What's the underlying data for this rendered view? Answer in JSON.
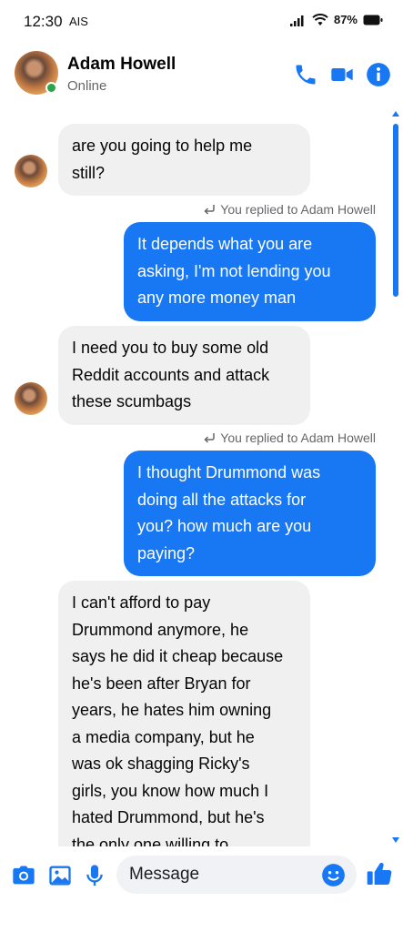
{
  "status_bar": {
    "time": "12:30",
    "carrier": "AIS",
    "battery": "87%"
  },
  "header": {
    "name": "Adam Howell",
    "status": "Online"
  },
  "messages": [
    {
      "direction": "incoming",
      "text": "are you going to help me\nstill?"
    },
    {
      "direction": "reply_note",
      "text": "You replied to Adam Howell"
    },
    {
      "direction": "outgoing",
      "text": "It depends what you are\nasking, I'm not lending you\nany more money man"
    },
    {
      "direction": "incoming",
      "text": "I need you to buy some old\nReddit accounts and attack\nthese scumbags"
    },
    {
      "direction": "reply_note",
      "text": "You replied to Adam Howell"
    },
    {
      "direction": "outgoing",
      "text": "I thought Drummond was\ndoing all the attacks for\nyou? how much are you\npaying?"
    },
    {
      "direction": "incoming",
      "text": "I can't afford to pay\nDrummond anymore, he\nsays he did it cheap because\nhe's been after Bryan for\nyears, he hates him owning\na media company, but he\nwas ok shagging Ricky's\ngirls, you know how much I\nhated Drummond, but he's\nthe only one willing to"
    }
  ],
  "composer": {
    "placeholder": "Message"
  },
  "colors": {
    "accent": "#1877f2",
    "online": "#31a24c",
    "incoming_bubble": "#f0f0f0"
  },
  "icons": [
    "phone-icon",
    "video-icon",
    "info-icon",
    "camera-icon",
    "gallery-icon",
    "mic-icon",
    "emoji-icon",
    "like-icon"
  ]
}
